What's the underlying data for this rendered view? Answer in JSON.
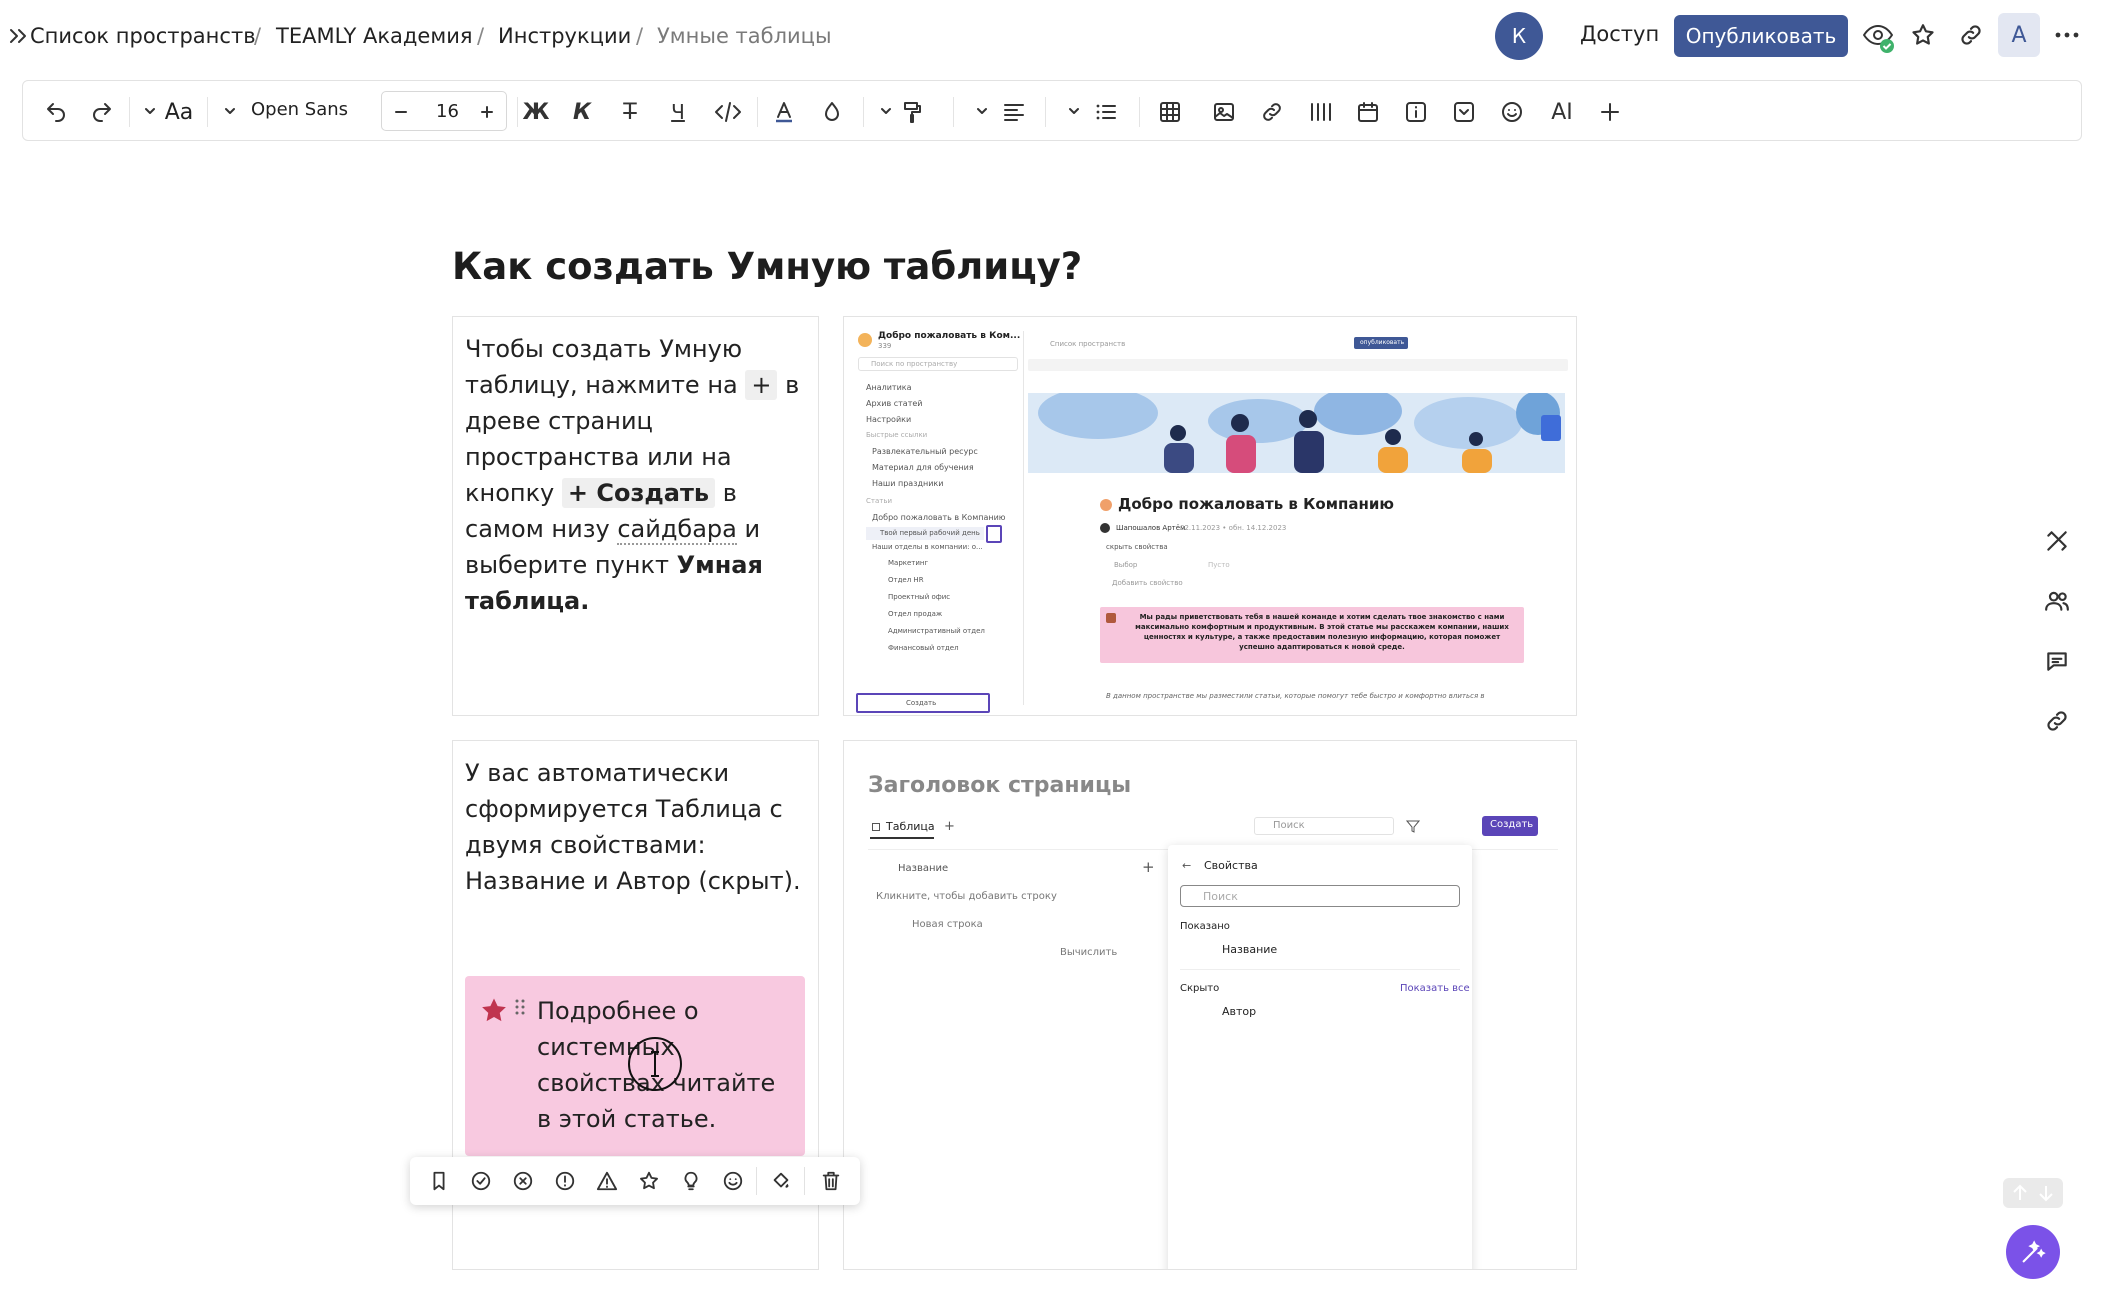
{
  "breadcrumb": {
    "items": [
      "Список пространств",
      "TEAMLY Академия",
      "Инструкции"
    ],
    "current": "Умные таблицы",
    "separator": "/"
  },
  "header": {
    "user_initial": "К",
    "access_label": "Доступ",
    "publish_label": "Опубликовать",
    "account_initial": "A"
  },
  "toolbar": {
    "text_style_label": "Aa",
    "font_name": "Open Sans",
    "font_size": "16",
    "bold": "Ж",
    "italic": "К",
    "strike": "Т",
    "underline": "Ч",
    "ai_label": "AI"
  },
  "page": {
    "title": "Как создать Умную таблицу?",
    "block1": {
      "t1": "Чтобы создать Умную таблицу, нажмите на",
      "plus": "+",
      "t2": "в древе страниц пространства или на кнопку",
      "create": "+ Создать",
      "t3": "в самом низу",
      "sidebar_word": "сайдбара",
      "t4": "и выберите пункт",
      "bold_end": "Умная таблица."
    },
    "block2_text": "У вас автоматически сформируется Таблица с двумя свойствами: Название и Автор (скрыт).",
    "callout_text": "Подробнее о системных свойствах читайте в этой статье."
  },
  "screenshot1": {
    "space_name": "Добро пожаловать в Ком...",
    "space_count": "339",
    "search_placeholder": "Поиск по пространству",
    "nav": [
      "Аналитика",
      "Архив статей",
      "Настройки"
    ],
    "quick_links_label": "Быстрые ссылки",
    "quick_links": [
      "Развлекательный ресурс",
      "Материал для обучения",
      "Наши праздники"
    ],
    "articles_label": "Статьи",
    "tree": [
      "Добро пожаловать в Компанию",
      "Твой первый рабочий день",
      "Наши отделы в компании: о..."
    ],
    "departments": [
      "Маркетинг",
      "Отдел HR",
      "Проектный офис",
      "Отдел продаж",
      "Административный отдел",
      "Финансовый отдел"
    ],
    "create_label": "Создать",
    "top_breadcrumb": "Список пространств",
    "publish_mini": "опубликовать",
    "doc_title": "Добро пожаловать в Компанию",
    "author": "Шапошалов Артём",
    "dates": "02.11.2023 • обн. 14.12.2023",
    "hide_props": "скрыть свойства",
    "prop_choice": "Выбор",
    "prop_empty": "Пусто",
    "add_prop": "Добавить свойство",
    "welcome_text": "Мы рады приветствовать тебя в нашей команде и хотим сделать твое знакомство с нами максимально комфортным и продуктивным. В этой статье мы расскажем компании, наших ценностях и культуре, а также предоставим полезную информацию, которая поможет успешно адаптироваться к новой среде.",
    "bottom_text": "В данном пространстве мы разместили статьи, которые помогут тебе быстро и комфортно влиться в"
  },
  "screenshot2": {
    "page_heading": "Заголовок страницы",
    "tab_label": "Таблица",
    "search_placeholder": "Поиск",
    "create_label": "Создать",
    "col_name": "Название",
    "add_row_hint": "Кликните, чтобы добавить строку",
    "new_row": "Новая строка",
    "compute": "Вычислить",
    "props_title": "Свойства",
    "props_search": "Поиск",
    "shown_label": "Показано",
    "prop_name": "Название",
    "hidden_label": "Скрыто",
    "show_all": "Показать все",
    "prop_author": "Автор"
  },
  "colors": {
    "brand": "#3f5896",
    "callout_bg": "#f8c9e0",
    "callout_star": "#c0344f",
    "assistant": "#7b52e8",
    "mini_purple": "#5b45b8",
    "mini_pink": "#f7c6dc"
  }
}
